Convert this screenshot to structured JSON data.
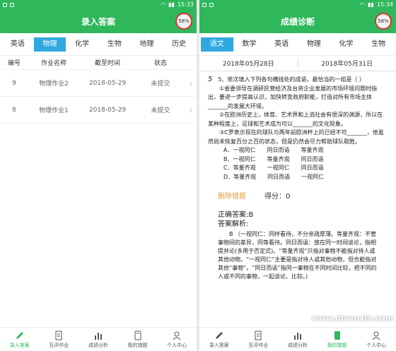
{
  "left": {
    "status": {
      "time": "15:33"
    },
    "title": "录入答案",
    "score_badge": "58%",
    "tabs": [
      "英语",
      "物理",
      "化学",
      "生物",
      "地理",
      "历史"
    ],
    "active_tab": 1,
    "table": {
      "headers": [
        "编号",
        "作业名称",
        "截至时间",
        "状态"
      ],
      "rows": [
        {
          "id": "9",
          "name": "物理作业2",
          "deadline": "2018-05-29",
          "status": "未提交"
        },
        {
          "id": "8",
          "name": "物理作业1",
          "deadline": "2018-05-29",
          "status": "未提交"
        }
      ]
    },
    "nav": [
      "录入答案",
      "互评作业",
      "成绩分析",
      "我的错题",
      "个人中心"
    ],
    "active_nav": 0
  },
  "right": {
    "status": {
      "time": "15:34"
    },
    "title": "成绩诊断",
    "score_badge": "58%",
    "tabs": [
      "语文",
      "数学",
      "英语",
      "物理",
      "化学",
      "生物"
    ],
    "active_tab": 0,
    "dates": [
      "2018年05月28日",
      "2018年05月31日"
    ],
    "question": {
      "number": "5",
      "stem": "5、依次填入下列各句横线处的成语，最恰当的一组是（ ）",
      "s1": "①省委领导在调研民营经济及台资企业发展的市场环境问题时指出，要进一步提高认识，加快转变政府职能，打造对所有市场主体_______的发展大环境。",
      "s2": "②在欧洲历史上，体育、艺术界和上流社会有很深的渊源，所以在某种程度上，足球和艺术成为可以_______的文化现象。",
      "s3": "③C罗表示现在的球队与两年前欧洲杯上的已经不可_______，他虽然尚未恢复百分之百的状态，但是仍然会尽力帮助球队取胜。",
      "options": [
        "A．一视同仁　　同日而语　　等量齐观",
        "B．一视同仁　　等量齐观　　同日而语",
        "C．等量齐观　　一视同仁　　同日而语",
        "D．等量齐观　　同日而语　　一视同仁"
      ]
    },
    "delete_label": "删除错题",
    "score_label": "得分：0",
    "correct_answer": "正确答案:B",
    "analysis_title": "答案解析:",
    "analysis_text": "B （一视同仁：同样看待，不分亲疏厚薄。等量齐观：不管事物间的差异，同等看待。同日而语：放在同一时间谈论，指相提并论(多用于否定式)。“等量齐观”只指对事物不能指对待人或其他动物。“一视同仁”主要是指对待人或其他动物，但也能指对其他“事物”。“同日而语”指同一事物在不同时间比较，把不同的人或不同的事物，一起谈论、比较。)",
    "nav": [
      "录入答案",
      "互评作业",
      "成绩分析",
      "我的错题",
      "个人中心"
    ],
    "active_nav": 3
  },
  "watermark": "www.downxia.com",
  "colors": {
    "brand": "#2fb75c",
    "tab_active": "#2fa8e0",
    "delete": "#e49a3c"
  }
}
